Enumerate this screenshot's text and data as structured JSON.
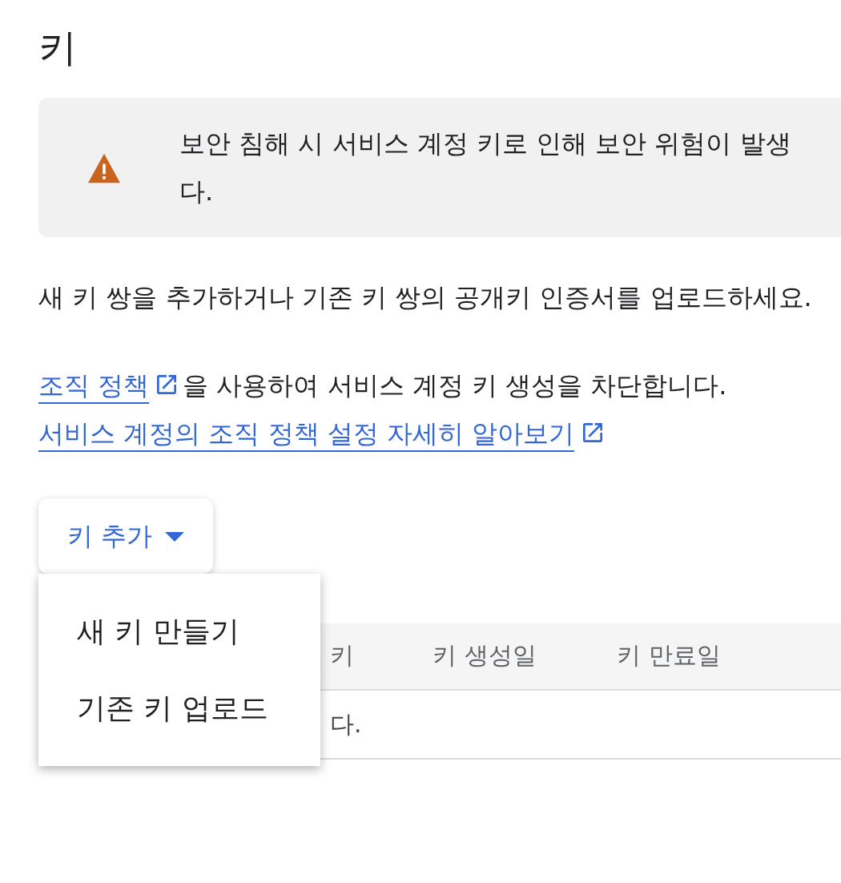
{
  "title": "키",
  "alert": {
    "lines": [
      "보안 침해 시 서비스 계정 키로 인해 보안 위험이 발생",
      "다."
    ]
  },
  "description": "새 키 쌍을 추가하거나 기존 키 쌍의 공개키 인증서를 업로드하세요.",
  "policy_line": {
    "link": "조직 정책",
    "text": "을 사용하여 서비스 계정 키 생성을 차단합니다."
  },
  "learn_more_link": "서비스 계정의 조직 정책 설정 자세히 알아보기",
  "add_key_button": {
    "label": "키 추가",
    "expanded": true
  },
  "menu_items": [
    "새 키 만들기",
    "기존 키 업로드"
  ],
  "table": {
    "columns": [
      "키",
      "키 생성일",
      "키 만료일"
    ],
    "empty_text": "다."
  }
}
